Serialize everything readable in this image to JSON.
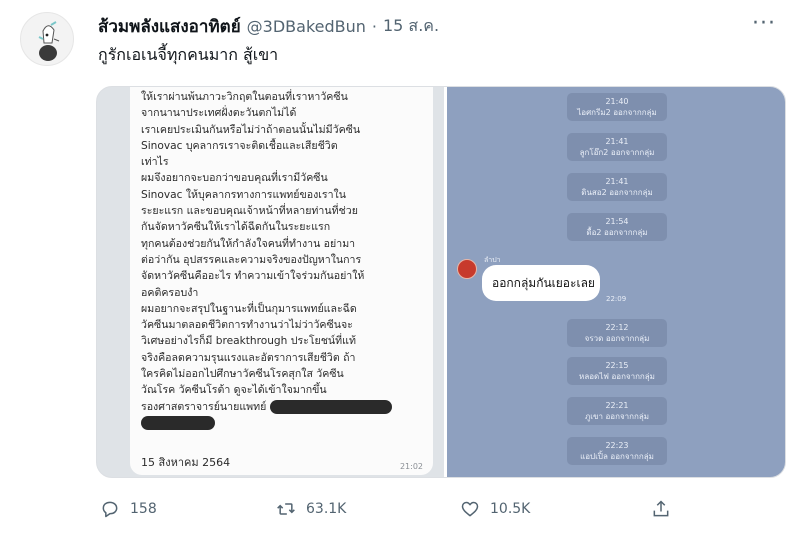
{
  "tweet": {
    "display_name": "ส้วมพลังแสงอาทิตย์",
    "handle": "@3DBakedBun",
    "separator": "·",
    "date": "15 ส.ค.",
    "more": "···",
    "text": "กูรักเอเนจี้ทุกคนมาก สู้เขา"
  },
  "image": {
    "document": {
      "lines": [
        "ให้เราผ่านพ้นภาวะวิกฤตในตอนที่เราหาวัคซีน",
        "จากนานาประเทศฝั่งตะวันตกไม่ได้",
        " เราเคยประเมินกันหรือไม่ว่าถ้าตอนนั้นไม่มีวัคซีน",
        "Sinovac บุคลากรเราจะติดเชื้อและเสียชีวิต",
        "เท่าไร",
        "ผมจึงอยากจะบอกว่าขอบคุณที่เรามีวัคซีน",
        "Sinovac ให้บุคลากรทางการแพทย์ของเราใน",
        "ระยะแรก และขอบคุณเจ้าหน้าที่หลายท่านที่ช่วย",
        "กันจัดหาวัคซีนให้เราได้ฉีดกันในระยะแรก",
        "ทุกคนต้องช่วยกันให้กำลังใจคนที่ทำงาน อย่ามา",
        "ต่อว่ากัน อุปสรรคและความจริงของปัญหาในการ",
        "จัดหาวัคซีนคืออะไร ทำความเข้าใจร่วมกันอย่าให้",
        "อคติครอบงำ",
        "ผมอยากจะสรุปในฐานะที่เป็นกุมารแพทย์และฉีด",
        "วัคซีนมาตลอดชีวิตการทำงานว่าไม่ว่าวัคซีนจะ",
        "วิเศษอย่างไรก็มี breakthrough ประโยชน์ที่แท้",
        "จริงคือลดความรุนแรงและอัตราการเสียชีวิต ถ้า",
        "ใครคิดไม่ออกไปศึกษาวัคซีนโรคสุกใส วัคซีน",
        "วัณโรค วัคซีนโรต้า ดูจะได้เข้าใจมากขึ้น",
        "รองศาสตราจารย์นายแพทย์"
      ],
      "date": "15 สิงหาคม 2564",
      "time": "21:02"
    },
    "chat": {
      "system_messages": [
        {
          "time": "21:40",
          "text": "ไอศกรีม2 ออกจากกลุ่ม"
        },
        {
          "time": "21:41",
          "text": "ลูกโอ๊ก2 ออกจากกลุ่ม"
        },
        {
          "time": "21:41",
          "text": "ดินสอ2 ออกจากกลุ่ม"
        },
        {
          "time": "21:54",
          "text": "ดื้อ2 ออกจากกลุ่ม"
        },
        {
          "time": "22:12",
          "text": "จรวด ออกจากกลุ่ม"
        },
        {
          "time": "22:15",
          "text": "หลอดไฟ ออกจากกลุ่ม"
        },
        {
          "time": "22:21",
          "text": "ภูเขา ออกจากกลุ่ม"
        },
        {
          "time": "22:23",
          "text": "แอปเปิ้ล ออกจากกลุ่ม"
        }
      ],
      "sender": "ลำปา",
      "message": "ออกกลุ่มกันเยอะเลย",
      "message_time": "22:09"
    }
  },
  "actions": {
    "reply_count": "158",
    "retweet_count": "63.1K",
    "like_count": "10.5K"
  },
  "icons": {
    "reply": "reply-icon",
    "retweet": "retweet-icon",
    "like": "heart-icon",
    "share": "share-icon",
    "more": "more-icon"
  },
  "colors": {
    "text": "#0f1419",
    "secondary": "#536471",
    "chat_bg": "#8ea0bf",
    "system_pill": "#7e8fae"
  }
}
